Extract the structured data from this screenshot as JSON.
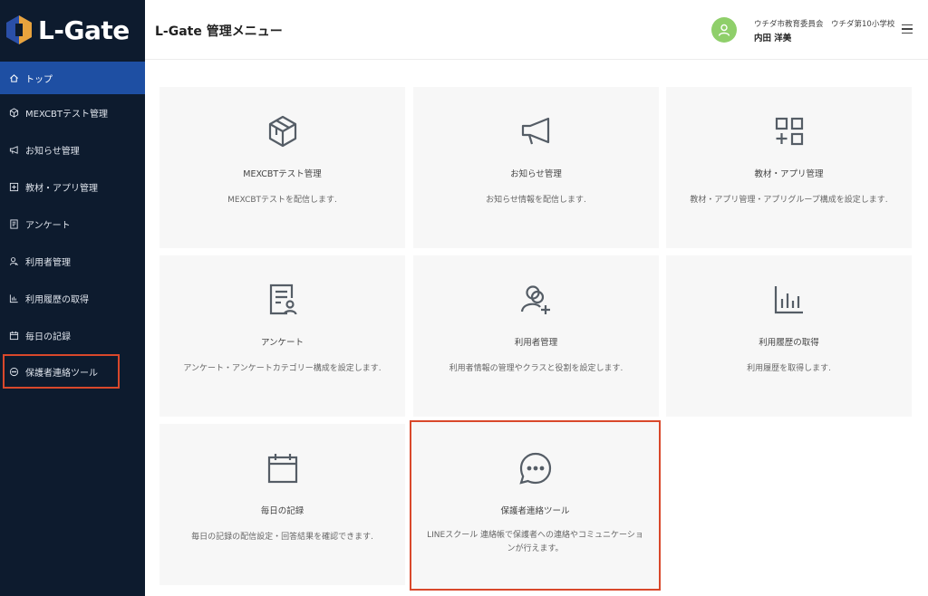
{
  "logo": {
    "text": "L-Gate"
  },
  "header": {
    "title": "L-Gate 管理メニュー",
    "user_org": "ウチダ市教育委員会　ウチダ第10小学校",
    "user_name": "内田 洋美"
  },
  "sidebar": {
    "items": [
      {
        "label": "トップ",
        "icon": "home-icon"
      },
      {
        "label": "MEXCBTテスト管理",
        "icon": "cube-icon"
      },
      {
        "label": "お知らせ管理",
        "icon": "megaphone-icon"
      },
      {
        "label": "教材・アプリ管理",
        "icon": "plus-square-icon"
      },
      {
        "label": "アンケート",
        "icon": "survey-icon"
      },
      {
        "label": "利用者管理",
        "icon": "users-icon"
      },
      {
        "label": "利用履歴の取得",
        "icon": "bar-chart-icon"
      },
      {
        "label": "毎日の記録",
        "icon": "calendar-icon"
      },
      {
        "label": "保護者連絡ツール",
        "icon": "chat-icon"
      }
    ]
  },
  "cards": [
    {
      "title": "MEXCBTテスト管理",
      "desc": "MEXCBTテストを配信します.",
      "icon": "cube-icon"
    },
    {
      "title": "お知らせ管理",
      "desc": "お知らせ情報を配信します.",
      "icon": "megaphone-icon"
    },
    {
      "title": "教材・アプリ管理",
      "desc": "教材・アプリ管理・アプリグループ構成を設定します.",
      "icon": "apps-grid-icon"
    },
    {
      "title": "アンケート",
      "desc": "アンケート・アンケートカテゴリー構成を設定します.",
      "icon": "survey-icon"
    },
    {
      "title": "利用者管理",
      "desc": "利用者情報の管理やクラスと役割を設定します.",
      "icon": "user-add-icon"
    },
    {
      "title": "利用履歴の取得",
      "desc": "利用履歴を取得します.",
      "icon": "bar-chart-icon"
    },
    {
      "title": "毎日の記録",
      "desc": "毎日の記録の配信設定・回答結果を確認できます.",
      "icon": "calendar-icon"
    },
    {
      "title": "保護者連絡ツール",
      "desc": "LINEスクール 連絡帳で保護者への連絡やコミュニケーションが行えます。",
      "icon": "chat-icon"
    }
  ],
  "colors": {
    "sidebar_bg": "#0d1b2e",
    "active_item": "#1e4fa3",
    "highlight_border": "#d9482b",
    "avatar_bg": "#8fcf6a",
    "icon_gray": "#555d66"
  }
}
